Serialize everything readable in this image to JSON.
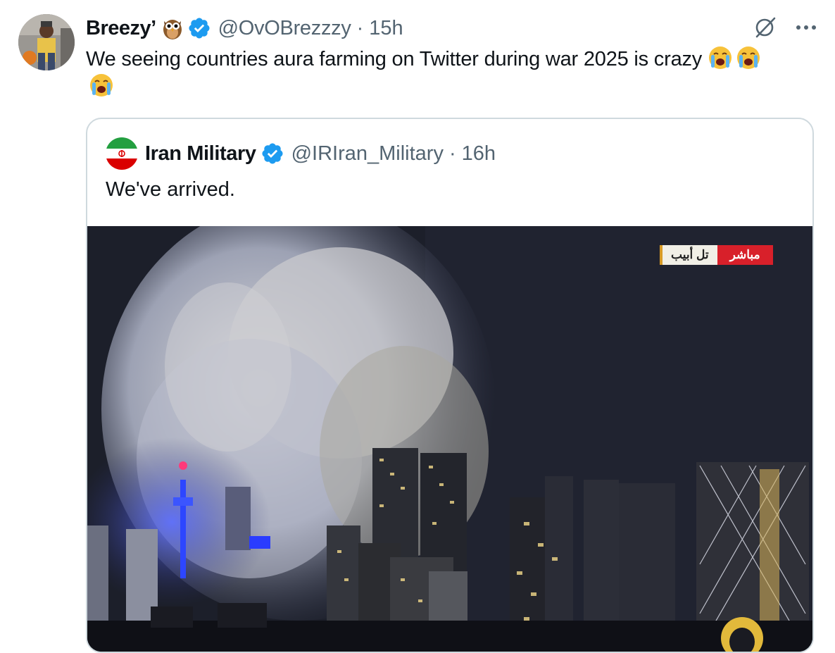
{
  "tweet": {
    "display_name": "Breezy’",
    "handle": "@OvOBrezzzy",
    "separator": "·",
    "time": "15h",
    "text": "We seeing countries aura farming on Twitter during war 2025 is crazy",
    "emoji": [
      "loudly-crying-face",
      "loudly-crying-face",
      "loudly-crying-face"
    ],
    "icons": [
      "owl-emoji",
      "verified-badge-icon",
      "grok-icon",
      "more-icon"
    ]
  },
  "quoted": {
    "display_name": "Iran Military",
    "handle": "@IRIran_Military",
    "separator": "·",
    "time": "16h",
    "text": "We've arrived.",
    "media": {
      "live_city": "تل أبيب",
      "live_label": "مباشر",
      "broadcaster_logo": "Al Jazeera"
    }
  },
  "colors": {
    "verified": "#1d9bf0",
    "text": "#0f1419",
    "secondary_text": "#536471",
    "border": "#cfd9de",
    "live_red": "#d8202a"
  }
}
